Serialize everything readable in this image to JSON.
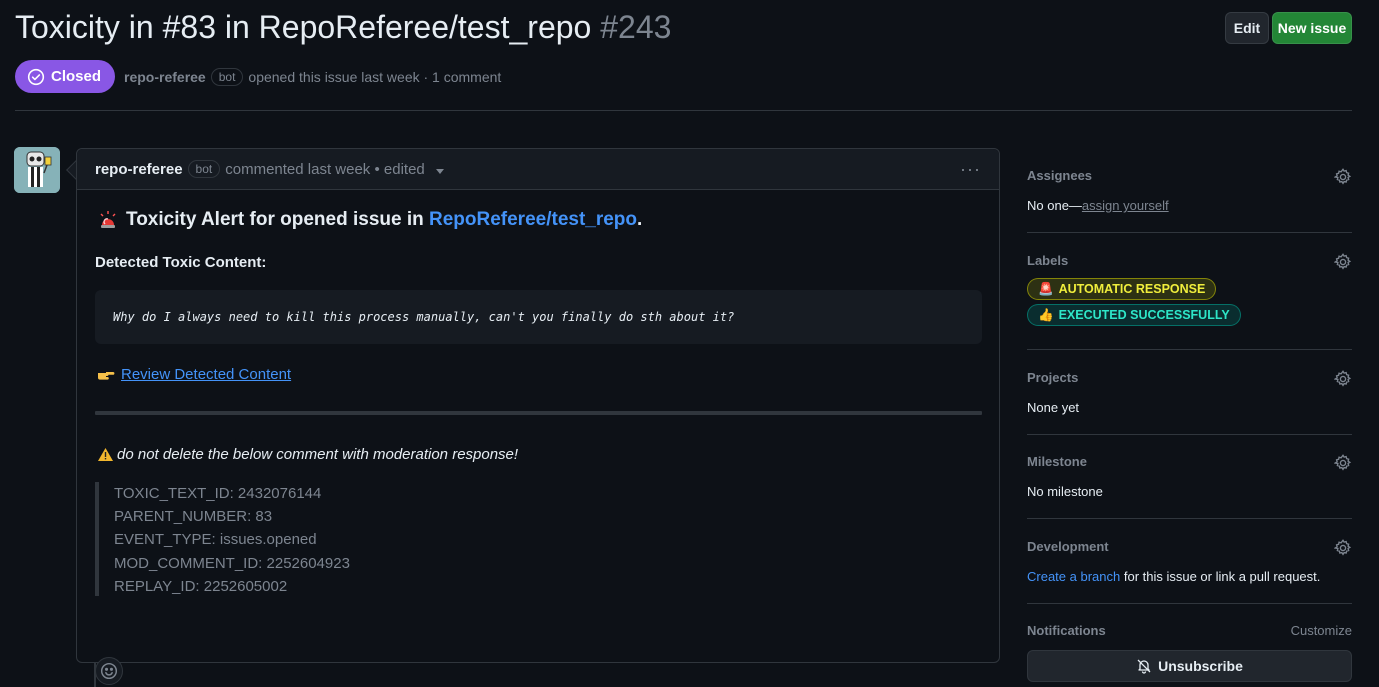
{
  "issue": {
    "title": "Toxicity in #83 in RepoReferee/test_repo",
    "number": "#243",
    "state": "Closed",
    "author": "repo-referee",
    "author_badge": "bot",
    "summary": "opened this issue last week · 1 comment"
  },
  "header_buttons": {
    "edit": "Edit",
    "new_issue": "New issue"
  },
  "comment": {
    "author": "repo-referee",
    "author_badge": "bot",
    "meta": "commented last week • edited",
    "menu": "···",
    "alert_prefix": "Toxicity Alert for opened issue in ",
    "alert_repo": "RepoReferee/test_repo",
    "alert_suffix": ".",
    "detected_label": "Detected Toxic Content:",
    "toxic_text": "Why do I always need to kill this process manually, can't you finally do sth about it?",
    "review_link": "Review Detected Content",
    "warning": "do not delete the below comment with moderation response!",
    "metadata": [
      "TOXIC_TEXT_ID: 2432076144",
      "PARENT_NUMBER: 83",
      "EVENT_TYPE: issues.opened",
      "MOD_COMMENT_ID: 2252604923",
      "REPLAY_ID: 2252605002"
    ]
  },
  "sidebar": {
    "assignees": {
      "heading": "Assignees",
      "value_prefix": "No one—",
      "value_link": "assign yourself"
    },
    "labels": {
      "heading": "Labels",
      "items": [
        {
          "text": "AUTOMATIC RESPONSE",
          "emoji": "🚨",
          "color": "#f0ee3c"
        },
        {
          "text": "EXECUTED SUCCESSFULLY",
          "emoji": "👍",
          "color": "#2ee6c8"
        }
      ]
    },
    "projects": {
      "heading": "Projects",
      "value": "None yet"
    },
    "milestone": {
      "heading": "Milestone",
      "value": "No milestone"
    },
    "development": {
      "heading": "Development",
      "link": "Create a branch",
      "rest": " for this issue or link a pull request."
    },
    "notifications": {
      "heading": "Notifications",
      "customize": "Customize",
      "button": "Unsubscribe"
    }
  },
  "colors": {
    "background": "#0d1117",
    "closed_badge": "#8957e5",
    "new_issue_button": "#238636",
    "link": "#4493f8"
  }
}
